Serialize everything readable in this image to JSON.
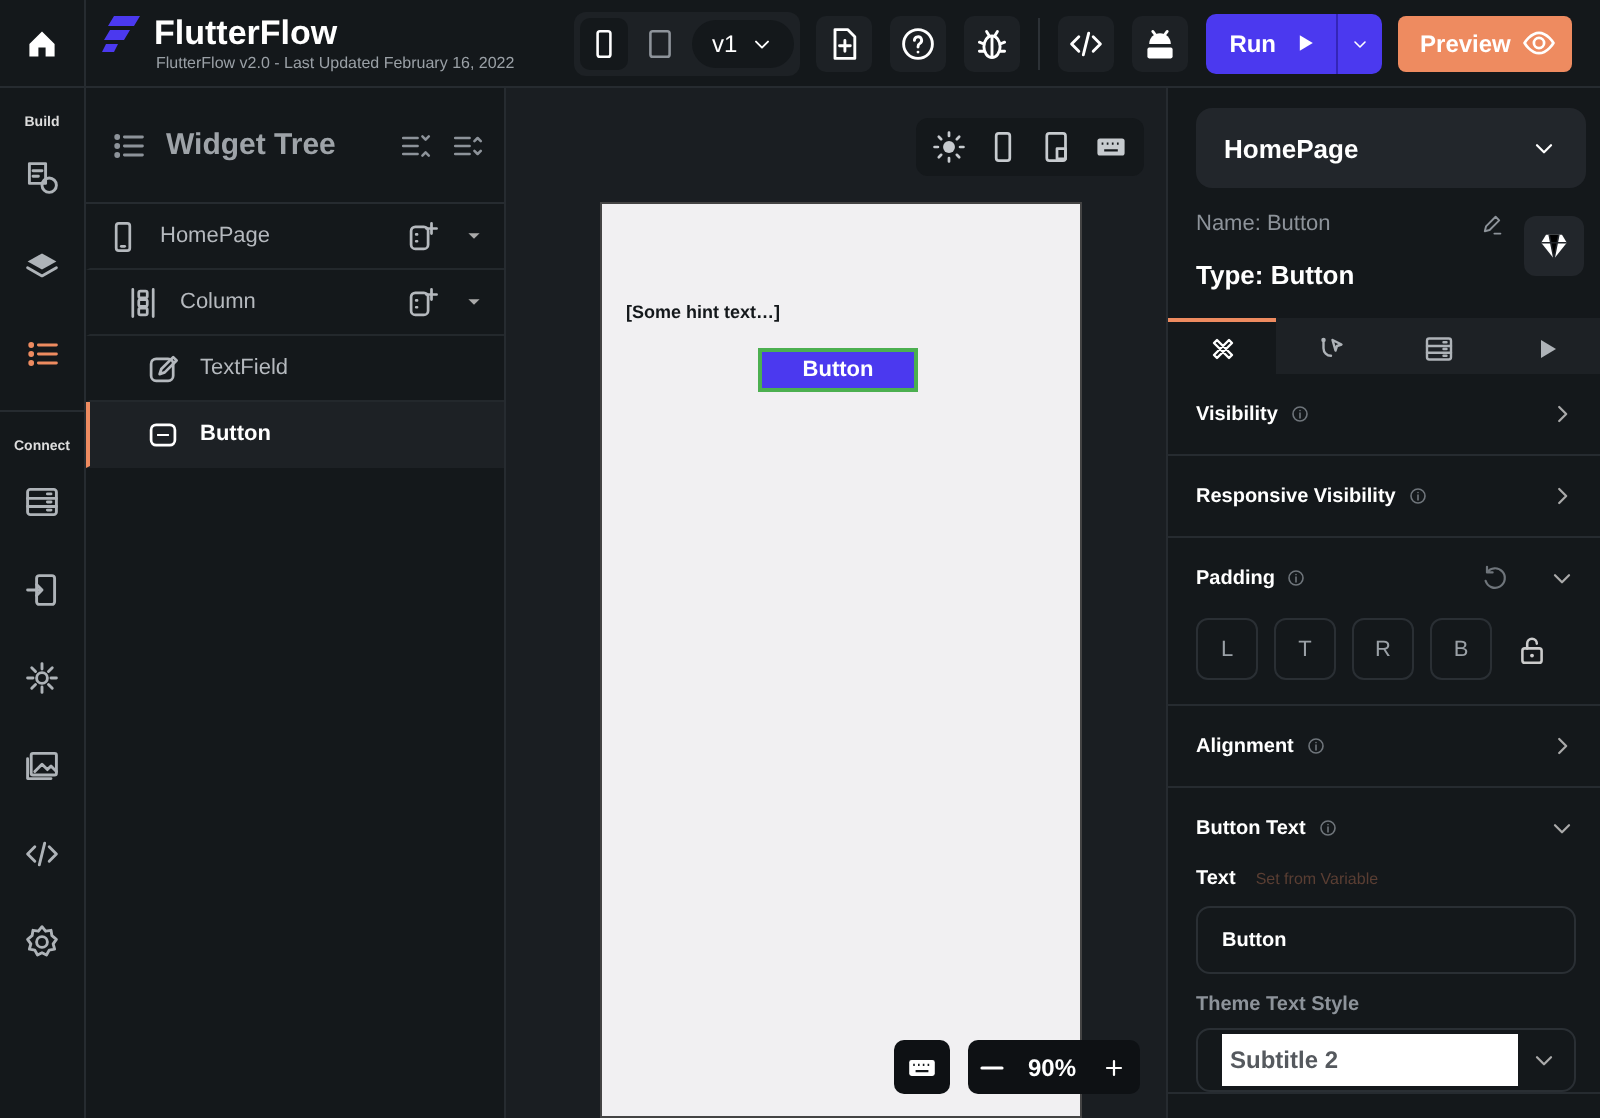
{
  "app": {
    "title": "FlutterFlow",
    "subtitle": "FlutterFlow v2.0 - Last Updated February 16, 2022"
  },
  "toolbar": {
    "devices": [
      {
        "kind": "phone",
        "selected": true
      },
      {
        "kind": "tablet",
        "selected": false
      }
    ],
    "version": "v1",
    "actions": [
      {
        "kind": "add-page"
      },
      {
        "kind": "help"
      },
      {
        "kind": "bug"
      },
      {
        "kind": "code"
      },
      {
        "kind": "apk"
      }
    ],
    "run": "Run",
    "preview": "Preview"
  },
  "rail": {
    "sections": [
      {
        "label": "Build",
        "items": [
          {
            "kind": "storyboard",
            "selected": false
          },
          {
            "kind": "layers",
            "selected": false
          },
          {
            "kind": "tree",
            "selected": true
          }
        ]
      },
      {
        "label": "Connect",
        "items": [
          {
            "kind": "database",
            "selected": false
          },
          {
            "kind": "api",
            "selected": false
          },
          {
            "kind": "puzzle",
            "selected": false
          },
          {
            "kind": "media",
            "selected": false
          },
          {
            "kind": "code",
            "selected": false
          },
          {
            "kind": "settings",
            "selected": false
          }
        ]
      }
    ]
  },
  "widget_tree": {
    "title": "Widget Tree",
    "nodes": [
      {
        "label": "HomePage",
        "kind": "page",
        "selected": false,
        "expanded": true,
        "children": [
          {
            "label": "Column",
            "kind": "column",
            "selected": false,
            "expanded": true,
            "children": [
              {
                "label": "TextField",
                "kind": "textfield",
                "selected": false
              },
              {
                "label": "Button",
                "kind": "button",
                "selected": true
              }
            ]
          }
        ]
      }
    ]
  },
  "canvas": {
    "hint": "[Some hint text…]",
    "button": "Button",
    "zoom": "90%"
  },
  "properties": {
    "page": "HomePage",
    "name_label": "Name:",
    "name": "Button",
    "type_label": "Type:",
    "type": "Button",
    "tabs": [
      {
        "kind": "design",
        "selected": true
      },
      {
        "kind": "actions",
        "selected": false
      },
      {
        "kind": "backend",
        "selected": false
      },
      {
        "kind": "play",
        "selected": false
      }
    ],
    "sections": [
      {
        "kind": "simple",
        "title": "Visibility",
        "expanded": false
      },
      {
        "kind": "simple",
        "title": "Responsive Visibility",
        "expanded": false
      },
      {
        "kind": "padding",
        "title": "Padding",
        "expanded": true,
        "fields": [
          {
            "placeholder": "L"
          },
          {
            "placeholder": "T"
          },
          {
            "placeholder": "R"
          },
          {
            "placeholder": "B"
          }
        ]
      },
      {
        "kind": "simple",
        "title": "Alignment",
        "expanded": false
      },
      {
        "kind": "text",
        "title": "Button Text",
        "expanded": true,
        "text_label": "Text",
        "variable_link": "Set from Variable",
        "value": "Button",
        "style_label": "Theme Text Style",
        "style": "Subtitle 2"
      }
    ]
  }
}
